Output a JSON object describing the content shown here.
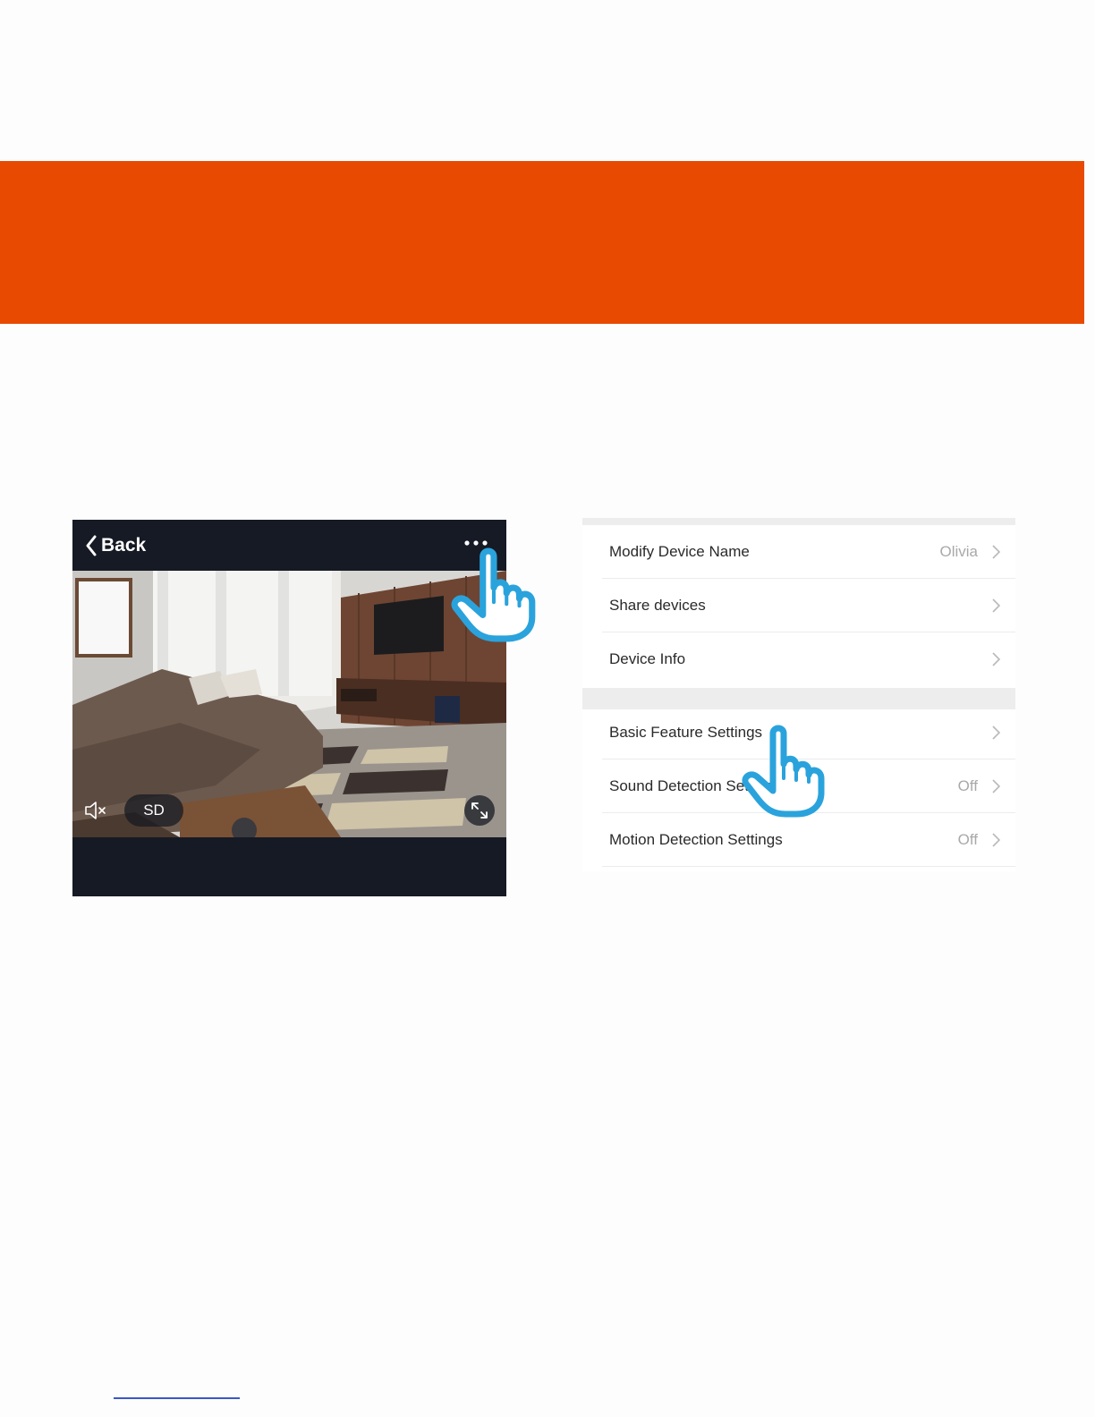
{
  "colors": {
    "banner": "#e84a02",
    "camera_bg": "#161a24",
    "pointer_hand": "#2aa3dc"
  },
  "camera_view": {
    "back_label": "Back",
    "back_icon": "chevron-left-icon",
    "more_icon": "ellipsis-icon",
    "mute_icon": "speaker-muted-icon",
    "quality_label": "SD",
    "fullscreen_icon": "fullscreen-icon"
  },
  "settings": {
    "group1": [
      {
        "label": "Modify Device Name",
        "value": "Olivia"
      },
      {
        "label": "Share devices",
        "value": ""
      },
      {
        "label": "Device Info",
        "value": ""
      }
    ],
    "group2": [
      {
        "label": "Basic Feature Settings",
        "value": ""
      },
      {
        "label": "Sound Detection Settings",
        "value": "Off"
      },
      {
        "label": "Motion Detection Settings",
        "value": "Off"
      }
    ]
  }
}
